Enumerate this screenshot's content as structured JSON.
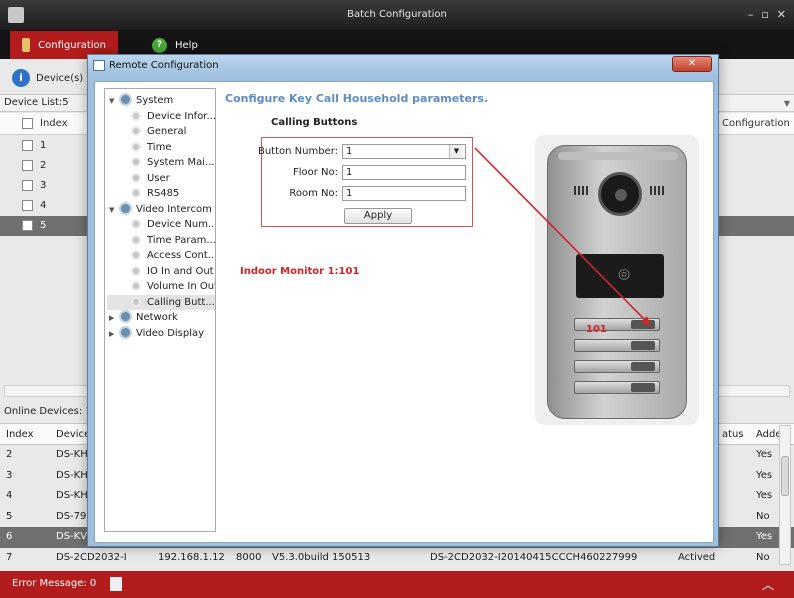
{
  "app": {
    "title": "Batch Configuration",
    "window_controls": [
      "–",
      "▫",
      "✕"
    ],
    "menu": {
      "configuration": "Configuration",
      "help": "Help"
    }
  },
  "main": {
    "device_button": "Device(s) m",
    "device_list_label": "Device List:5",
    "columns": {
      "index": "Index",
      "configuration": "Configuration"
    },
    "devices": [
      "1",
      "2",
      "3",
      "4",
      "5"
    ],
    "online_label": "Online Devices: 10",
    "online_columns": {
      "index": "Index",
      "device": "Device",
      "status": "atus",
      "added": "Adde"
    },
    "online_rows": [
      {
        "index": "2",
        "device": "DS-KH",
        "added": "Yes"
      },
      {
        "index": "3",
        "device": "DS-KH",
        "added": "Yes"
      },
      {
        "index": "4",
        "device": "DS-KH",
        "added": "Yes"
      },
      {
        "index": "5",
        "device": "DS-790",
        "added": "No"
      },
      {
        "index": "6",
        "device": "DS-KV",
        "added": "Yes"
      },
      {
        "index": "7",
        "device": "DS-2CD2032-I",
        "ip": "192.168.1.12",
        "port": "8000",
        "version": "V5.3.0build 150513",
        "serial": "DS-2CD2032-I20140415CCCH460227999",
        "status": "Actived",
        "added": "No"
      }
    ]
  },
  "status_bar": {
    "error_message": "Error Message:  0"
  },
  "dialog": {
    "title": "Remote Configuration",
    "close": "✕",
    "tree": [
      {
        "label": "System",
        "level": 0
      },
      {
        "label": "Device Infor...",
        "level": 1
      },
      {
        "label": "General",
        "level": 1
      },
      {
        "label": "Time",
        "level": 1
      },
      {
        "label": "System Mai...",
        "level": 1
      },
      {
        "label": "User",
        "level": 1
      },
      {
        "label": "RS485",
        "level": 1
      },
      {
        "label": "Video Intercom",
        "level": 0
      },
      {
        "label": "Device Num...",
        "level": 1
      },
      {
        "label": "Time Param...",
        "level": 1
      },
      {
        "label": "Access Cont...",
        "level": 1
      },
      {
        "label": "IO In and Out",
        "level": 1
      },
      {
        "label": "Volume In Out",
        "level": 1
      },
      {
        "label": "Calling Butt...",
        "level": 1,
        "selected": true
      },
      {
        "label": "Network",
        "level": 0
      },
      {
        "label": "Video Display",
        "level": 0
      }
    ],
    "panel_title": "Configure Key Call Household parameters.",
    "section_title": "Calling Buttons",
    "form": {
      "button_number_label": "Button Number:",
      "button_number_value": "1",
      "floor_label": "Floor No:",
      "floor_value": "1",
      "room_label": "Room No:",
      "room_value": "1",
      "apply": "Apply"
    },
    "monitor_note": "Indoor Monitor 1:101",
    "key_label": "101"
  },
  "colors": {
    "accent_red": "#b31c1c",
    "link_blue": "#5b8dc4",
    "annotation_red": "#d02525"
  }
}
